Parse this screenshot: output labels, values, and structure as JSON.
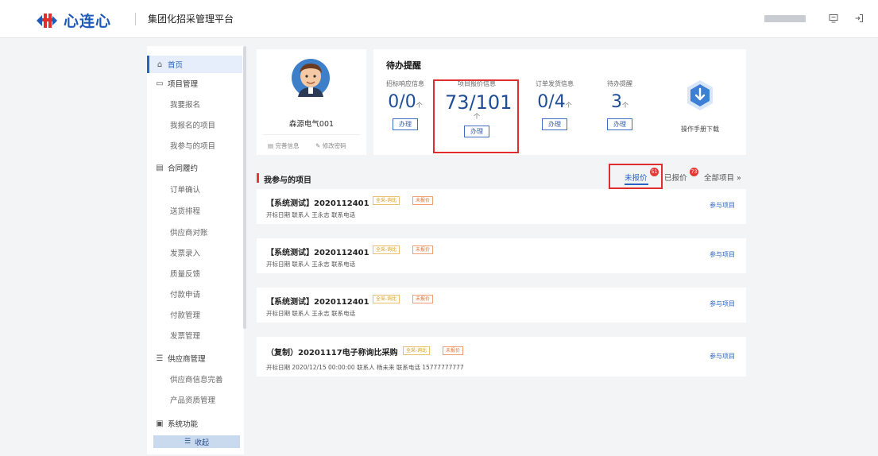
{
  "header": {
    "logo_text": "心连心",
    "platform_title": "集团化招采管理平台",
    "icons": [
      "monitor-icon",
      "logout-icon"
    ],
    "brand_colors": {
      "blue": "#1e5bb8",
      "red": "#e02d2d"
    }
  },
  "sidebar": {
    "home": "首页",
    "groups": [
      {
        "label": "项目管理",
        "icon": "folder-icon",
        "items": [
          "我要报名",
          "我报名的项目",
          "我参与的项目"
        ]
      },
      {
        "label": "合同履约",
        "icon": "contract-icon",
        "items": [
          "订单确认",
          "送货排程",
          "供应商对账",
          "发票录入",
          "质量反馈",
          "付款申请",
          "付款管理",
          "发票管理"
        ]
      },
      {
        "label": "供应商管理",
        "icon": "database-icon",
        "items": [
          "供应商信息完善",
          "产品资质管理"
        ]
      },
      {
        "label": "系统功能",
        "icon": "settings-icon",
        "items": []
      }
    ],
    "collapse_label": "收起"
  },
  "profile": {
    "name": "森源电气001",
    "link_complete": "完善信息",
    "link_password": "修改密码"
  },
  "todo": {
    "title": "待办提醒",
    "unit": "个",
    "action": "办理",
    "kpis": [
      {
        "label": "招标响应信息",
        "value": "0/0"
      },
      {
        "label": "项目报价信息",
        "value": "73/101"
      },
      {
        "label": "订单发货信息",
        "value": "0/4"
      },
      {
        "label": "待办提醒",
        "value": "3"
      }
    ],
    "manual_label": "操作手册下载"
  },
  "projects": {
    "section_title": "我参与的项目",
    "tabs": {
      "unquoted": "未报价",
      "unquoted_count": "51",
      "quoted": "已报价",
      "quoted_count": "73",
      "all": "全部项目 »"
    },
    "action_label": "参与项目",
    "list": [
      {
        "title": "【系统测试】2020112401",
        "tag1": "全采-询比",
        "tag2": "未报价",
        "meta": "开标日期   联系人  王永志  联系电话"
      },
      {
        "title": "【系统测试】2020112401",
        "tag1": "全采-询比",
        "tag2": "未报价",
        "meta": "开标日期   联系人  王永志  联系电话"
      },
      {
        "title": "【系统测试】2020112401",
        "tag1": "全采-询比",
        "tag2": "未报价",
        "meta": "开标日期   联系人  王永志  联系电话"
      },
      {
        "title": "（复制）20201117电子称询比采购",
        "tag1": "全采-询比",
        "tag2": "未报价",
        "meta": "开标日期  2020/12/15 00:00:00  联系人  杨未来  联系电话  15777777777"
      }
    ]
  }
}
